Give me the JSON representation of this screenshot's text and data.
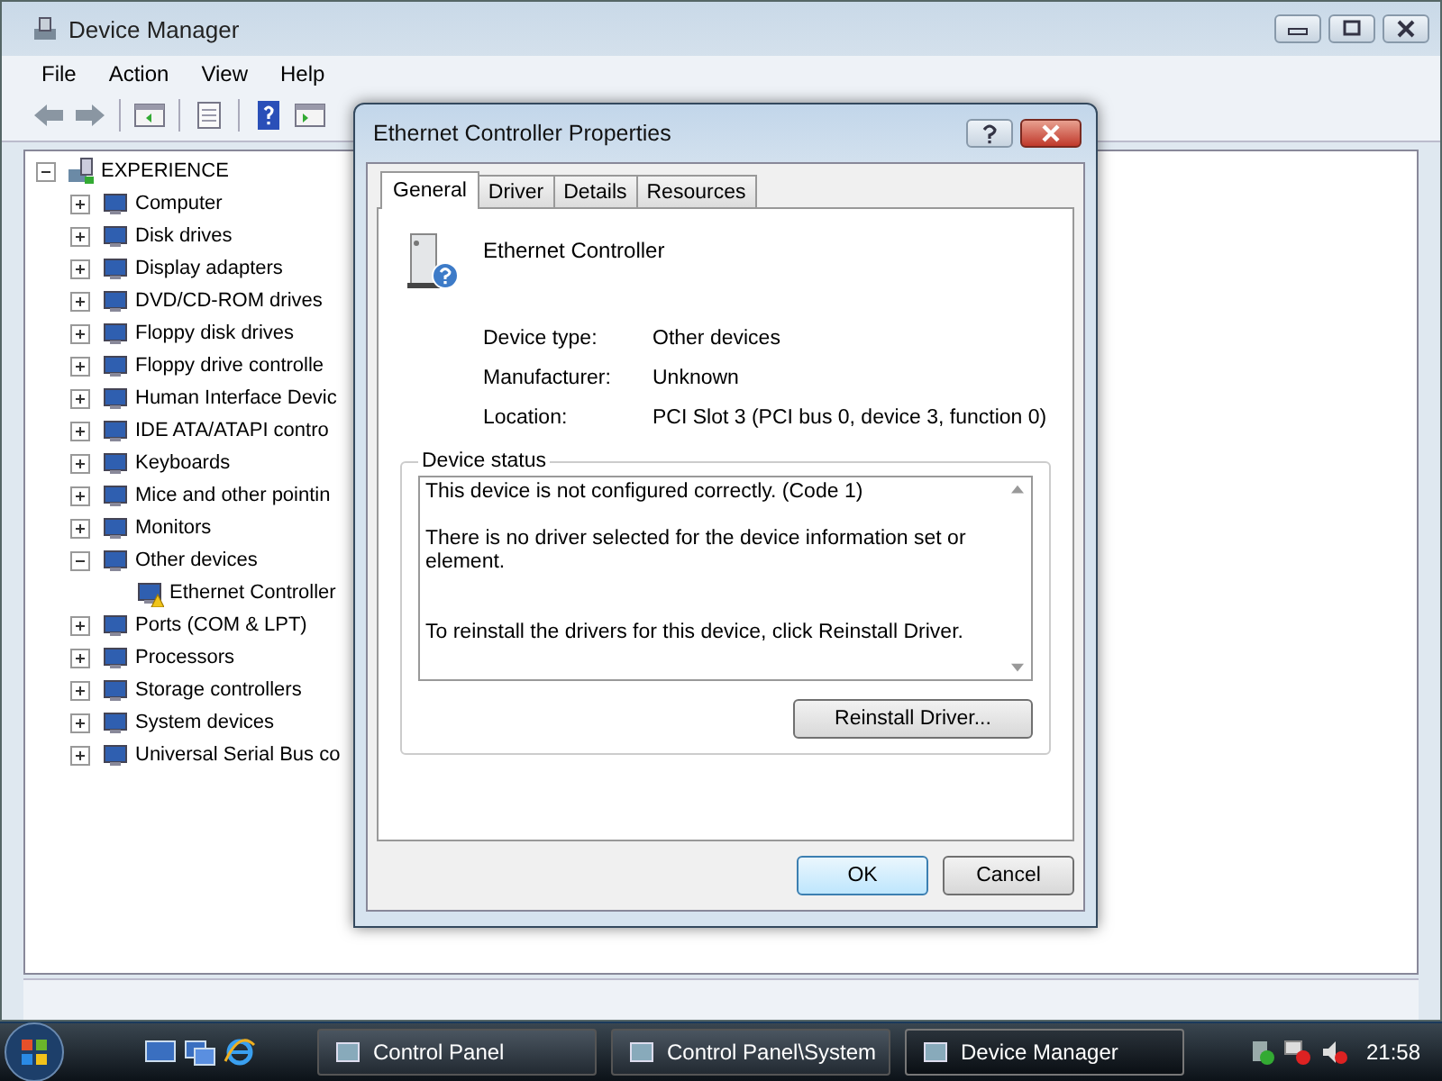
{
  "window": {
    "title": "Device Manager"
  },
  "menu": [
    "File",
    "Action",
    "View",
    "Help"
  ],
  "tree": [
    {
      "label": "EXPERIENCE",
      "expanded": true,
      "children": [
        {
          "label": "Computer",
          "expanded": false
        },
        {
          "label": "Disk drives",
          "expanded": false
        },
        {
          "label": "Display adapters",
          "expanded": false
        },
        {
          "label": "DVD/CD-ROM drives",
          "expanded": false
        },
        {
          "label": "Floppy disk drives",
          "expanded": false
        },
        {
          "label": "Floppy drive controlle",
          "expanded": false
        },
        {
          "label": "Human Interface Devic",
          "expanded": false
        },
        {
          "label": "IDE ATA/ATAPI contro",
          "expanded": false
        },
        {
          "label": "Keyboards",
          "expanded": false
        },
        {
          "label": "Mice and other pointin",
          "expanded": false
        },
        {
          "label": "Monitors",
          "expanded": false
        },
        {
          "label": "Other devices",
          "expanded": true,
          "children": [
            {
              "label": "Ethernet Controller",
              "warning": true
            }
          ]
        },
        {
          "label": "Ports (COM & LPT)",
          "expanded": false
        },
        {
          "label": "Processors",
          "expanded": false
        },
        {
          "label": "Storage controllers",
          "expanded": false
        },
        {
          "label": "System devices",
          "expanded": false
        },
        {
          "label": "Universal Serial Bus co",
          "expanded": false
        }
      ]
    }
  ],
  "dialog": {
    "title": "Ethernet Controller Properties",
    "tabs": [
      {
        "label": "General",
        "selected": true
      },
      {
        "label": "Driver",
        "selected": false
      },
      {
        "label": "Details",
        "selected": false
      },
      {
        "label": "Resources",
        "selected": false
      }
    ],
    "device_name": "Ethernet Controller",
    "properties": [
      {
        "label": "Device type:",
        "value": "Other devices"
      },
      {
        "label": "Manufacturer:",
        "value": "Unknown"
      },
      {
        "label": "Location:",
        "value": "PCI Slot 3 (PCI bus 0, device 3, function 0)"
      }
    ],
    "status_group": "Device status",
    "status_text": [
      "This device is not configured correctly. (Code 1)",
      "There is no driver selected for the device information set or element.",
      "To reinstall the drivers for this device, click Reinstall Driver."
    ],
    "reinstall_button": "Reinstall Driver...",
    "buttons": [
      "OK",
      "Cancel"
    ]
  },
  "taskbar": {
    "tasks": [
      {
        "label": "Control Panel",
        "selected": false
      },
      {
        "label": "Control Panel\\System",
        "selected": false
      },
      {
        "label": "Device Manager",
        "selected": true
      }
    ],
    "clock": "21:58"
  }
}
